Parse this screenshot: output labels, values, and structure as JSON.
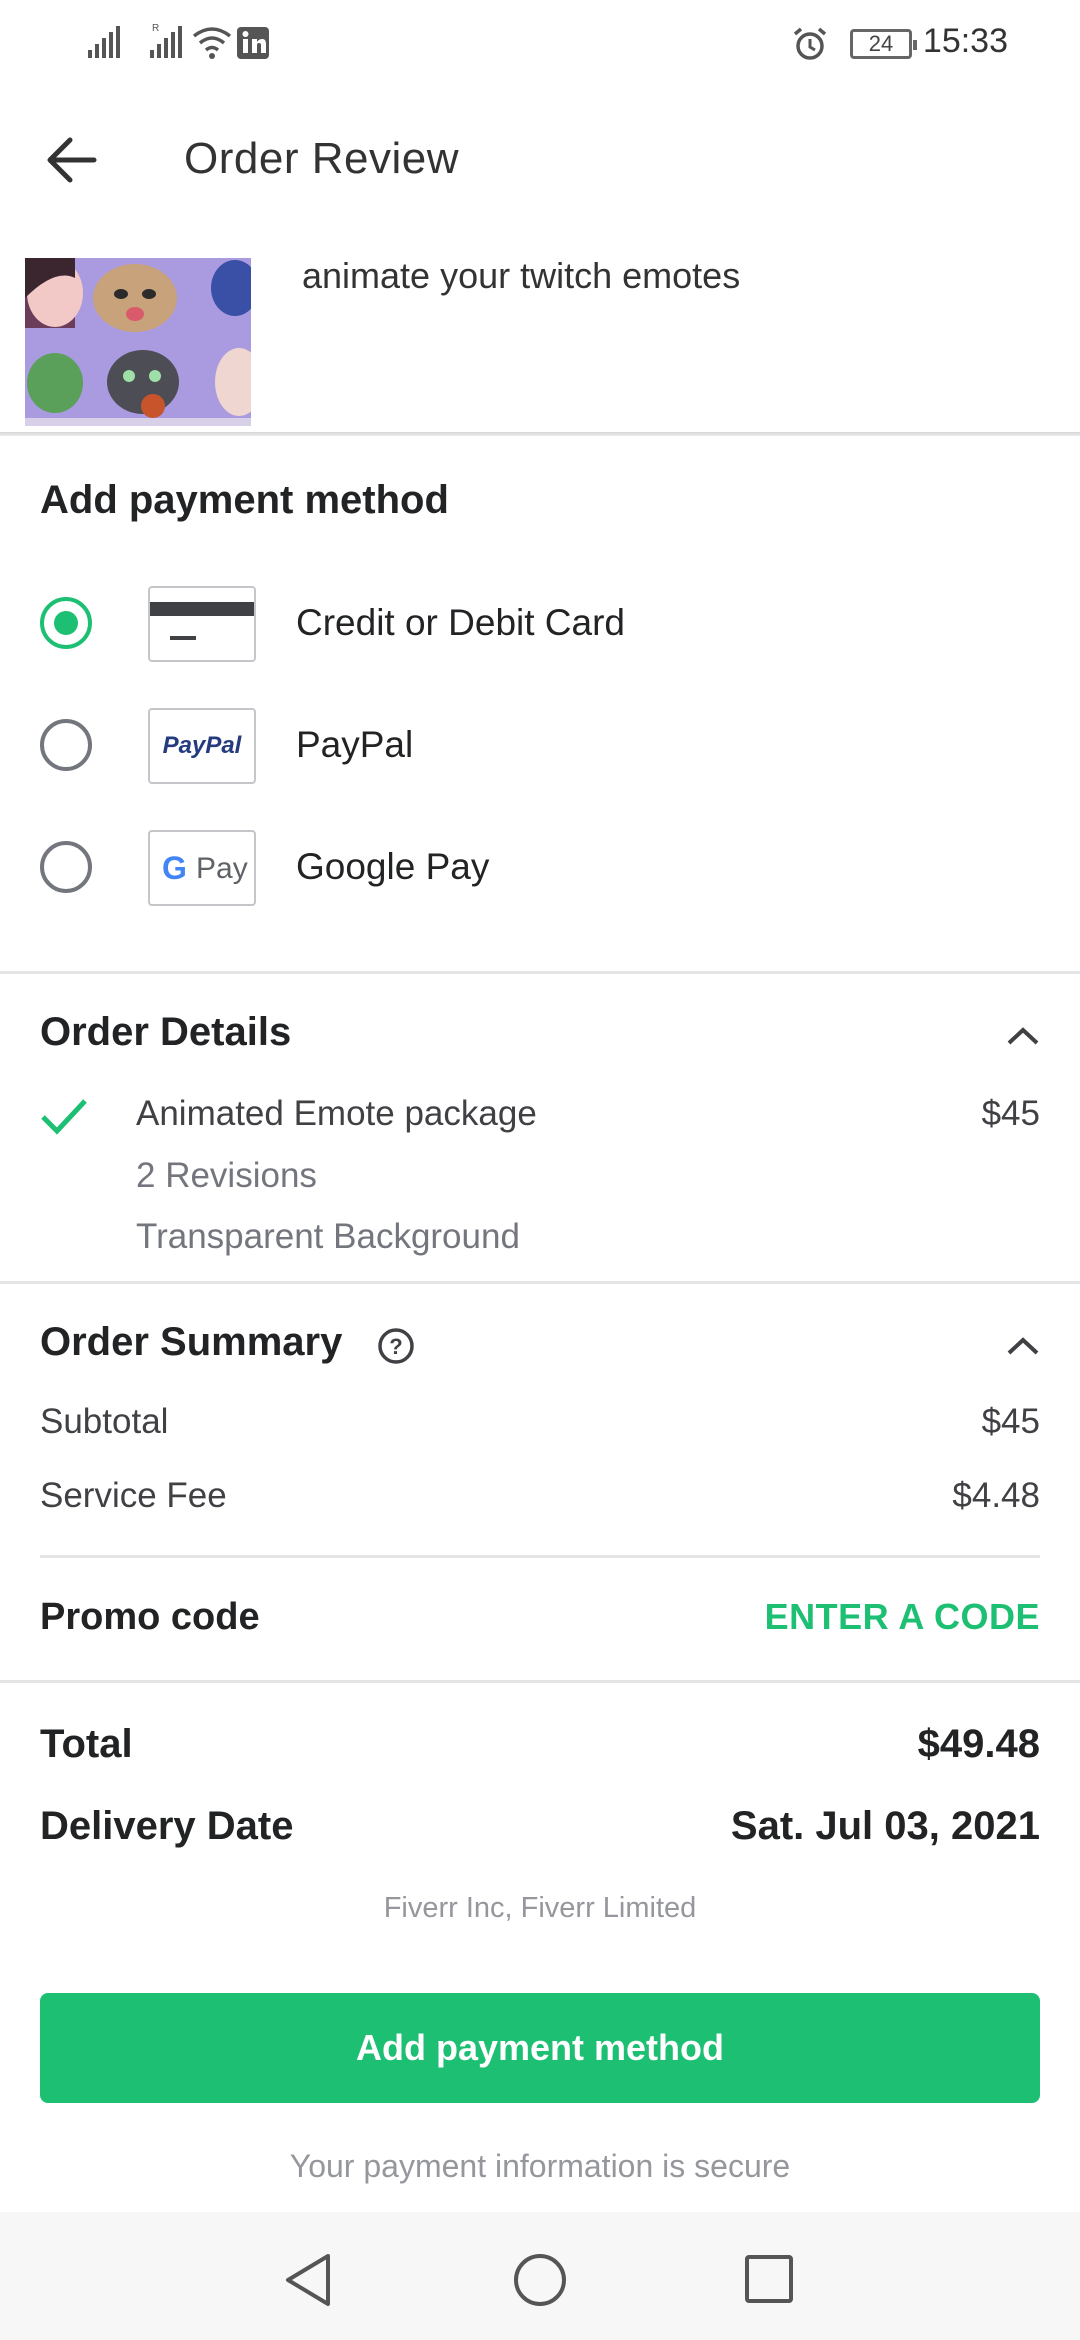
{
  "status_bar": {
    "time": "15:33",
    "battery": "24",
    "icons": [
      "signal-icon",
      "signal-roaming-icon",
      "wifi-icon",
      "linkedin-icon",
      "alarm-icon",
      "battery-icon"
    ]
  },
  "header": {
    "title": "Order Review",
    "back_icon": "arrow-left-icon"
  },
  "gig": {
    "title": "animate your twitch emotes"
  },
  "payment": {
    "heading": "Add payment method",
    "options": [
      {
        "label": "Credit or Debit Card",
        "selected": true,
        "icon": "credit-card-icon"
      },
      {
        "label": "PayPal",
        "selected": false,
        "icon": "paypal-logo",
        "logo_text": "PayPal"
      },
      {
        "label": "Google Pay",
        "selected": false,
        "icon": "google-pay-logo",
        "logo_text": "Pay"
      }
    ]
  },
  "order_details": {
    "heading": "Order Details",
    "package": "Animated Emote package",
    "price": "$45",
    "features": [
      "2 Revisions",
      "Transparent Background"
    ]
  },
  "order_summary": {
    "heading": "Order Summary",
    "subtotal_label": "Subtotal",
    "subtotal": "$45",
    "fee_label": "Service Fee",
    "fee": "$4.48",
    "promo_label": "Promo code",
    "promo_action": "ENTER A CODE"
  },
  "totals": {
    "total_label": "Total",
    "total": "$49.48",
    "delivery_label": "Delivery Date",
    "delivery": "Sat. Jul 03, 2021"
  },
  "legal": "Fiverr Inc, Fiverr Limited",
  "cta_label": "Add payment method",
  "secure_note": "Your payment information is secure",
  "colors": {
    "accent": "#1dbf73",
    "text": "#222325",
    "muted": "#74767e"
  }
}
